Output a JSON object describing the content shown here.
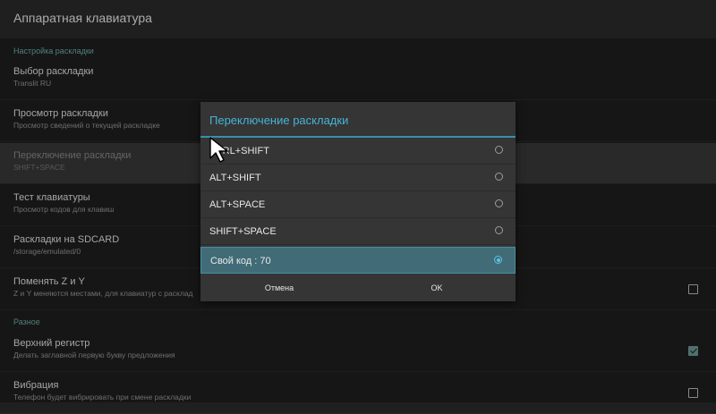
{
  "appbar": {
    "title": "Аппаратная клавиатура"
  },
  "sections": {
    "layout": "Настройка раскладки",
    "misc": "Разное"
  },
  "prefs": [
    {
      "title": "Выбор раскладки",
      "summary": "Translit RU"
    },
    {
      "title": "Просмотр раскладки",
      "summary": "Просмотр сведений о текущей раскладке"
    },
    {
      "title": "Переключение раскладки",
      "summary": "SHIFT+SPACE"
    },
    {
      "title": "Тест клавиатуры",
      "summary": "Просмотр кодов для клавиш"
    },
    {
      "title": "Раскладки на SDCARD",
      "summary": "/storage/emulated/0"
    },
    {
      "title": "Поменять Z и Y",
      "summary": "Z и Y меняются местами, для клавиатур с расклад",
      "checked": false
    },
    {
      "title": "Верхний регистр",
      "summary": "Делать заглавной первую букву предложения",
      "checked": true
    },
    {
      "title": "Вибрация",
      "summary": "Телефон будет вибрировать при смене раскладки",
      "checked": false
    }
  ],
  "dialog": {
    "title": "Переключение раскладки",
    "options": [
      {
        "label": "CTRL+SHIFT",
        "selected": false
      },
      {
        "label": "ALT+SHIFT",
        "selected": false
      },
      {
        "label": "ALT+SPACE",
        "selected": false
      },
      {
        "label": "SHIFT+SPACE",
        "selected": false
      },
      {
        "label": "Свой код : 70",
        "selected": true
      }
    ],
    "cancel_label": "Отмена",
    "ok_label": "OK"
  },
  "colors": {
    "accent": "#45b4d6",
    "section": "#6fb1a9",
    "selected_option": "#416c77"
  }
}
